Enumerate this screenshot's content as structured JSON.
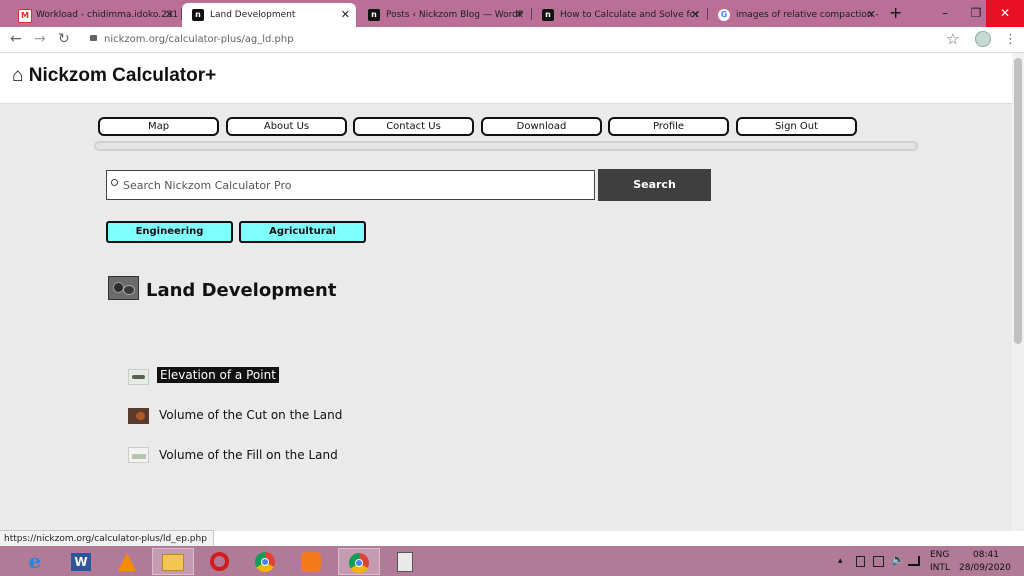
{
  "browser": {
    "tabs": [
      {
        "title": "Workload - chidimma.idoko.231",
        "favicon": "gmail-icon",
        "active": false
      },
      {
        "title": "Land Development",
        "favicon": "nickzom-icon",
        "active": true
      },
      {
        "title": "Posts ‹ Nickzom Blog — WordP",
        "favicon": "nickzom-icon",
        "active": false
      },
      {
        "title": "How to Calculate and Solve for",
        "favicon": "nickzom-icon",
        "active": false
      },
      {
        "title": "images of relative compaction -",
        "favicon": "google-icon",
        "active": false
      }
    ],
    "new_tab": "+",
    "close_glyph": "✕",
    "window_controls": {
      "minimize": "–",
      "restore": "❐",
      "close": "✕"
    },
    "back": "←",
    "forward": "→",
    "reload": "↻",
    "url": "nickzom.org/calculator-plus/ag_ld.php",
    "star": "☆"
  },
  "site": {
    "title": "Nickzom Calculator+",
    "home_icon": "⌂"
  },
  "nav": [
    "Map",
    "About Us",
    "Contact Us",
    "Download",
    "Profile",
    "Sign Out"
  ],
  "search": {
    "placeholder": "Search Nickzom Calculator Pro",
    "button": "Search"
  },
  "categories": [
    "Engineering",
    "Agricultural"
  ],
  "section": {
    "title": "Land Development"
  },
  "items": [
    {
      "label": "Elevation of a Point",
      "highlighted": true
    },
    {
      "label": "Volume of the Cut on the Land",
      "highlighted": false
    },
    {
      "label": "Volume of the Fill on the Land",
      "highlighted": false
    }
  ],
  "status_url": "https://nickzom.org/calculator-plus/ld_ep.php",
  "taskbar": {
    "apps": [
      "internet-explorer-icon",
      "word-icon",
      "vlc-icon",
      "file-explorer-icon",
      "opera-icon",
      "chrome-icon",
      "uc-browser-icon",
      "chrome-active-icon",
      "calculator-icon"
    ],
    "language": "ENG",
    "layout": "INTL",
    "time": "08:41",
    "date": "28/09/2020",
    "tray_arrow": "▴"
  },
  "colors": {
    "tab_strip": "#b96f96",
    "taskbar": "#b17a96",
    "category_bg": "#80ffff",
    "search_button": "#3f3f3f"
  }
}
